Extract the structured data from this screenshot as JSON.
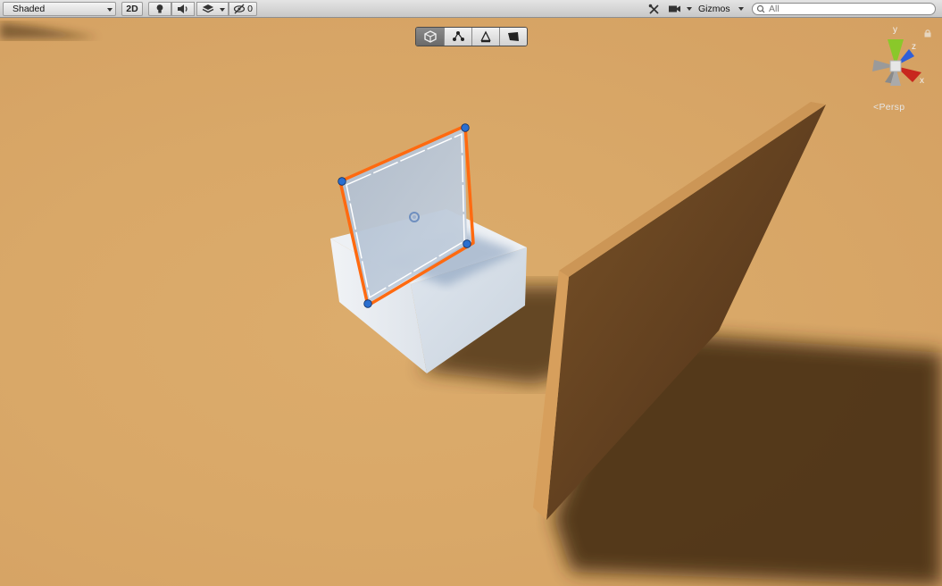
{
  "toolbar": {
    "shading_mode": "Shaded",
    "mode_2d_label": "2D",
    "hidden_count": "0",
    "gizmos_label": "Gizmos",
    "search_placeholder": "All"
  },
  "icons": {
    "lighting": "lightbulb-icon",
    "audio": "speaker-icon",
    "effects": "layers-icon",
    "hidden": "eye-slash-icon",
    "tools": "tools-icon",
    "camera": "camera-icon",
    "search": "search-icon",
    "lock": "lock-icon"
  },
  "edit_modes": [
    {
      "name": "object-mode",
      "icon": "cube-icon",
      "active": true
    },
    {
      "name": "vertex-mode",
      "icon": "vertex-icon",
      "active": false
    },
    {
      "name": "edge-mode",
      "icon": "edge-icon",
      "active": false
    },
    {
      "name": "face-mode",
      "icon": "face-icon",
      "active": false
    }
  ],
  "orientation_gizmo": {
    "axis_labels": {
      "x": "x",
      "y": "y",
      "z": "z"
    },
    "projection_label": "Persp",
    "colors": {
      "x": "#c8261e",
      "y": "#8ac82a",
      "z": "#2f5fd8"
    }
  },
  "scene": {
    "ground_color": "#d8a767",
    "selection_color": "#ff6a10",
    "vertex_color": "#2a6fd0"
  }
}
